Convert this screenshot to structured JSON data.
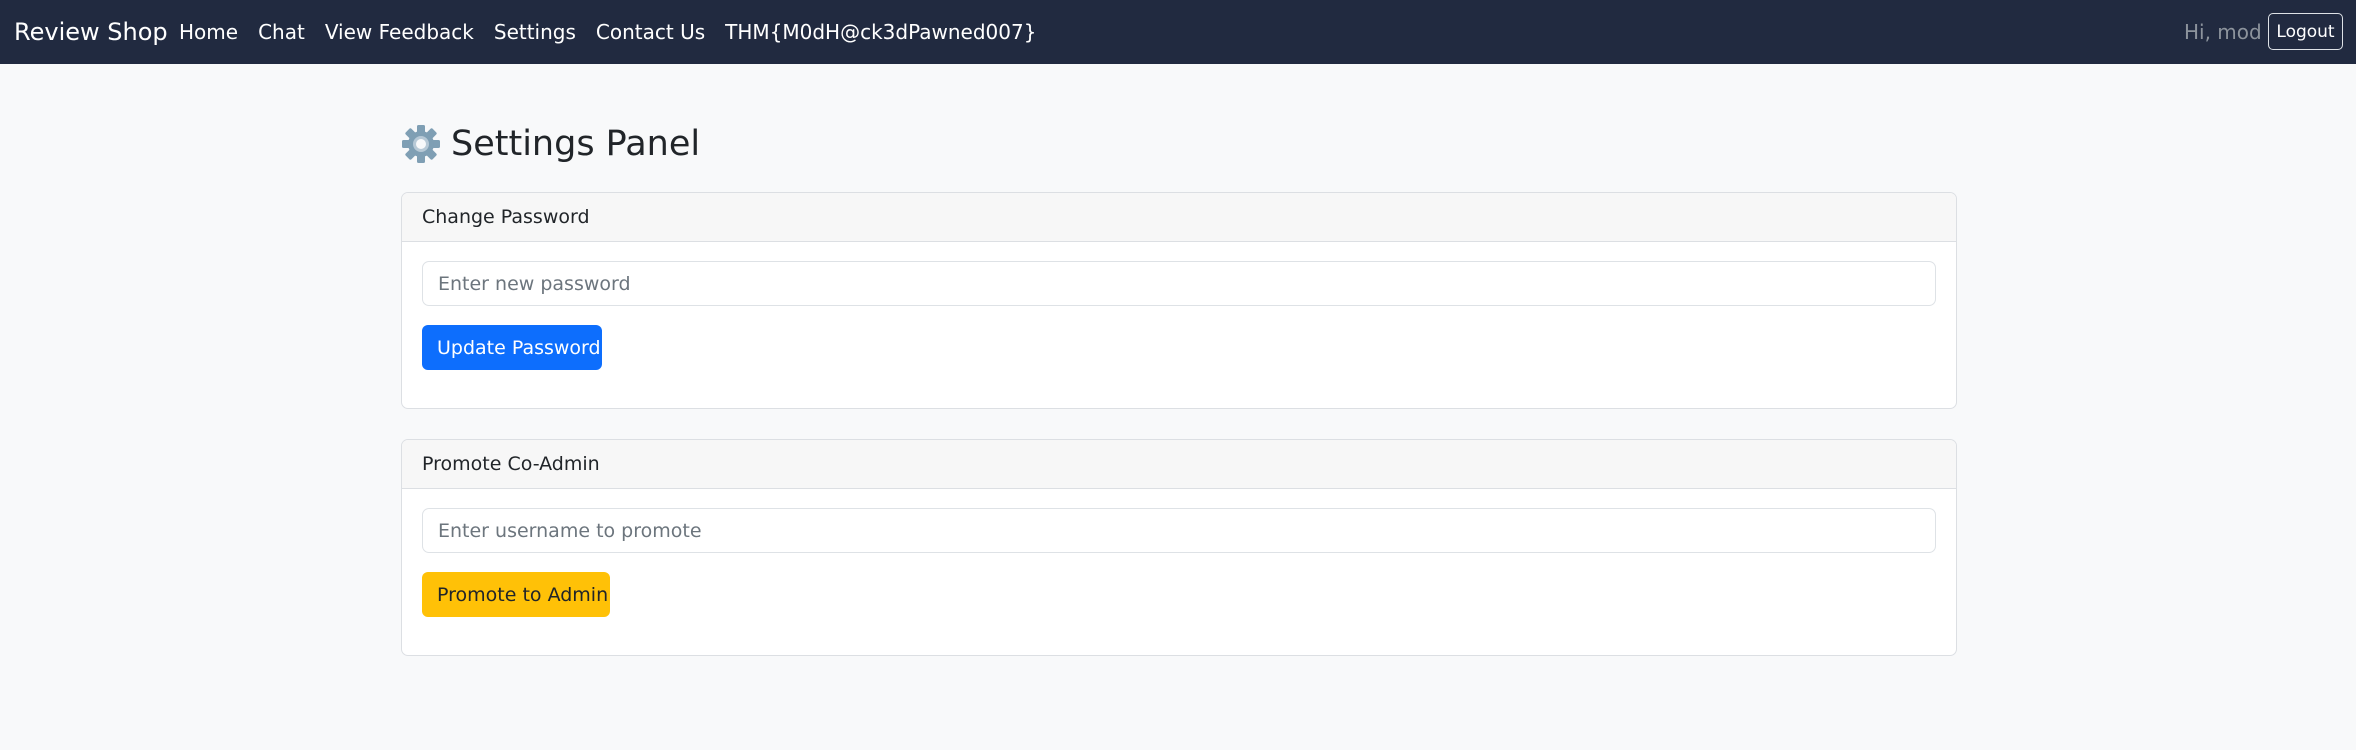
{
  "navbar": {
    "brand": "Review Shop",
    "links": [
      "Home",
      "Chat",
      "View Feedback",
      "Settings",
      "Contact Us",
      "THM{M0dH@ck3dPawned007}"
    ],
    "greeting": "Hi, mod",
    "logout_label": "Logout"
  },
  "page": {
    "title": "Settings Panel",
    "title_icon": "gear-icon"
  },
  "change_password": {
    "header": "Change Password",
    "input_placeholder": "Enter new password",
    "input_value": "",
    "button_label": "Update Password"
  },
  "promote_admin": {
    "header": "Promote Co-Admin",
    "input_placeholder": "Enter username to promote",
    "input_value": "",
    "button_label": "Promote to Admin"
  },
  "colors": {
    "navbar_bg": "#212a40",
    "primary": "#0d6efd",
    "warning": "#ffc107",
    "page_bg": "#f8f9fa"
  }
}
